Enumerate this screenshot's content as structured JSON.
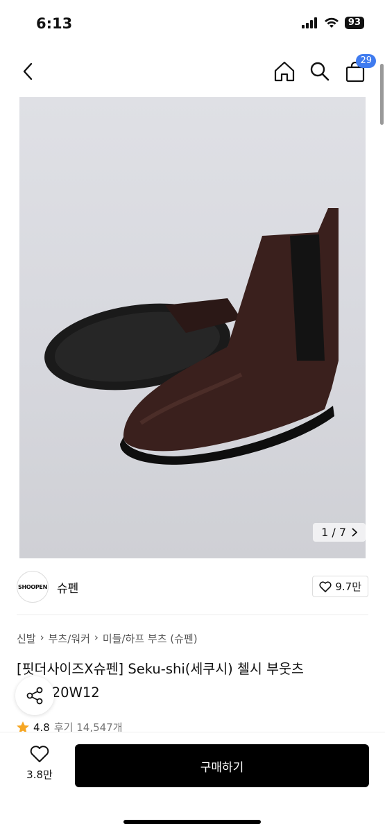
{
  "status": {
    "time": "6:13",
    "battery": "93"
  },
  "header": {
    "cart_count": "29"
  },
  "gallery": {
    "counter": "1 / 7"
  },
  "seller": {
    "logo_text": "SHOOPEN",
    "name": "슈펜",
    "likes": "9.7만"
  },
  "breadcrumb": {
    "items": [
      "신발",
      "부츠/워커",
      "미들/하프 부츠 (슈펜)"
    ]
  },
  "product": {
    "title": "[핏더사이즈X슈펜] Seku-shi(세쿠시) 첼시 부웃츠 HWM20W12",
    "rating": "4.8",
    "reviews": "후기 14,547개"
  },
  "bottom": {
    "wish_count": "3.8만",
    "buy_label": "구매하기"
  },
  "colors": {
    "accent": "#3f7bef",
    "buy_bg": "#000000"
  }
}
